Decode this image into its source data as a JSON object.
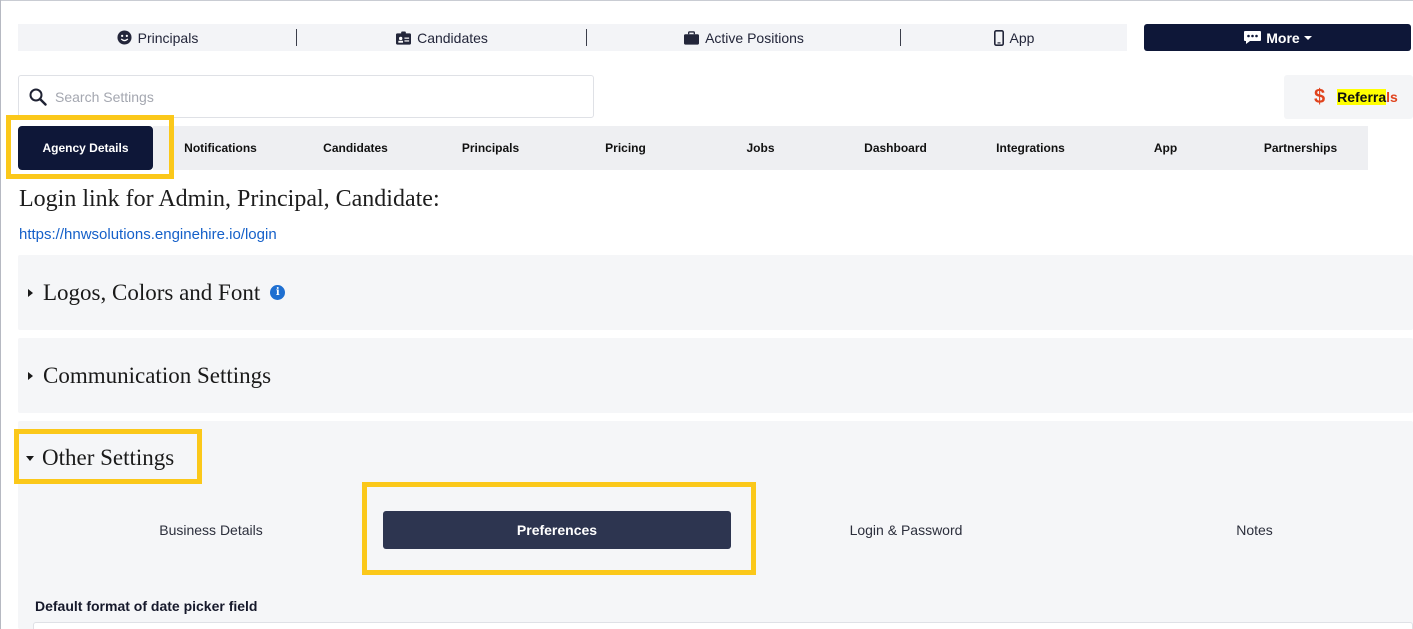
{
  "nav": {
    "items": [
      {
        "label": "Principals",
        "icon": "smile-icon"
      },
      {
        "label": "Candidates",
        "icon": "id-badge-icon"
      },
      {
        "label": "Active Positions",
        "icon": "briefcase-icon"
      },
      {
        "label": "App",
        "icon": "mobile-icon"
      }
    ],
    "more_label": "More",
    "more_icon": "comment-dots-icon"
  },
  "search": {
    "placeholder": "Search Settings",
    "value": ""
  },
  "referrals": {
    "highlighted": "Referra",
    "rest": "ls",
    "icon": "dollar-icon"
  },
  "tabs": [
    {
      "label": "Agency Details",
      "active": true
    },
    {
      "label": "Notifications"
    },
    {
      "label": "Candidates"
    },
    {
      "label": "Principals"
    },
    {
      "label": "Pricing"
    },
    {
      "label": "Jobs"
    },
    {
      "label": "Dashboard"
    },
    {
      "label": "Integrations"
    },
    {
      "label": "App"
    },
    {
      "label": "Partnerships"
    }
  ],
  "login": {
    "title": "Login link for Admin, Principal, Candidate:",
    "link": "https://hnwsolutions.enginehire.io/login"
  },
  "sections": [
    {
      "title": "Logos, Colors and Font",
      "expanded": false,
      "has_info": true
    },
    {
      "title": "Communication Settings",
      "expanded": false
    },
    {
      "title": "Other Settings",
      "expanded": true
    }
  ],
  "subtabs": [
    {
      "label": "Business Details"
    },
    {
      "label": "Preferences",
      "active": true
    },
    {
      "label": "Login & Password"
    },
    {
      "label": "Notes"
    }
  ],
  "fields": {
    "date_format_label": "Default format of date picker field"
  },
  "colors": {
    "primary_dark": "#0e1738",
    "active_subtab": "#2d3550",
    "highlight": "#fbc81a",
    "link": "#1560c9",
    "referral_accent": "#e0431d"
  }
}
